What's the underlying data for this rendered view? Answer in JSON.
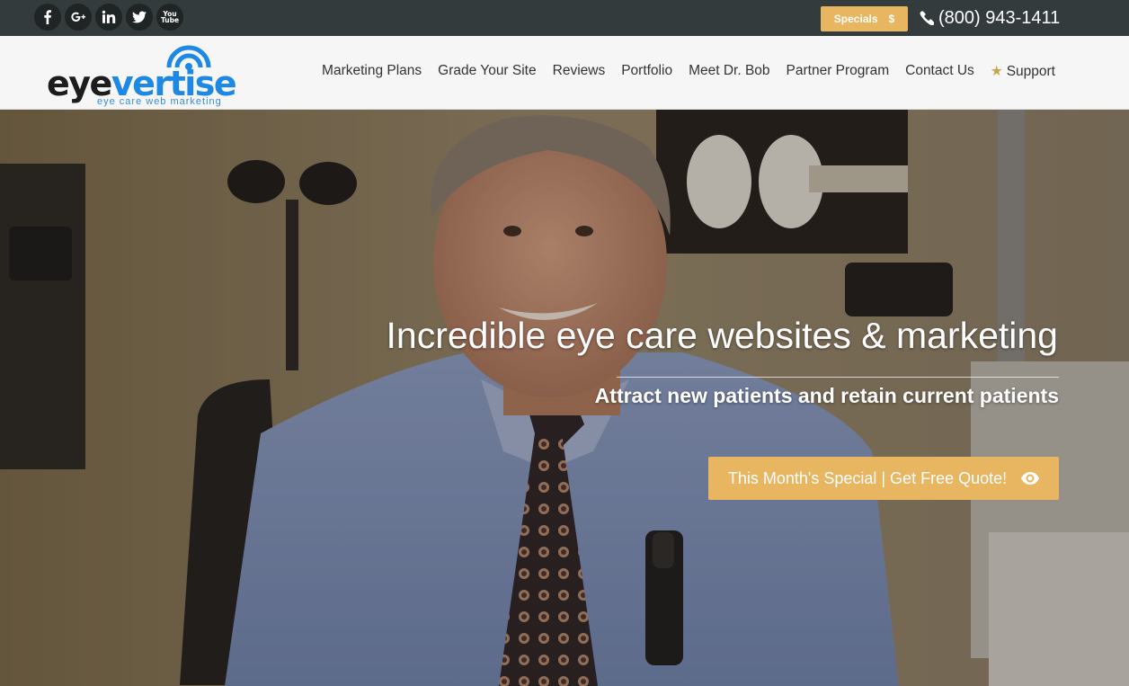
{
  "social": [
    {
      "name": "facebook-icon"
    },
    {
      "name": "google-plus-icon"
    },
    {
      "name": "linkedin-icon"
    },
    {
      "name": "twitter-icon"
    },
    {
      "name": "youtube-icon",
      "label_top": "You",
      "label_bottom": "Tube"
    }
  ],
  "topbar": {
    "specials_label": "Specials",
    "specials_symbol": "$",
    "phone": "(800) 943-1411"
  },
  "logo": {
    "word_a": "eye",
    "word_b": "vertise",
    "tagline": "eye care web marketing"
  },
  "nav": {
    "items": [
      "Marketing Plans",
      "Grade Your Site",
      "Reviews",
      "Portfolio",
      "Meet Dr. Bob",
      "Partner Program",
      "Contact Us"
    ],
    "support_label": "Support"
  },
  "hero": {
    "headline": "Incredible eye care websites & marketing",
    "subhead": "Attract new patients and retain current patients",
    "cta_label": "This Month's Special | Get Free Quote!"
  },
  "colors": {
    "topbar": "#343b3c",
    "accent": "#e8b560",
    "brand_blue": "#1e88e5"
  }
}
